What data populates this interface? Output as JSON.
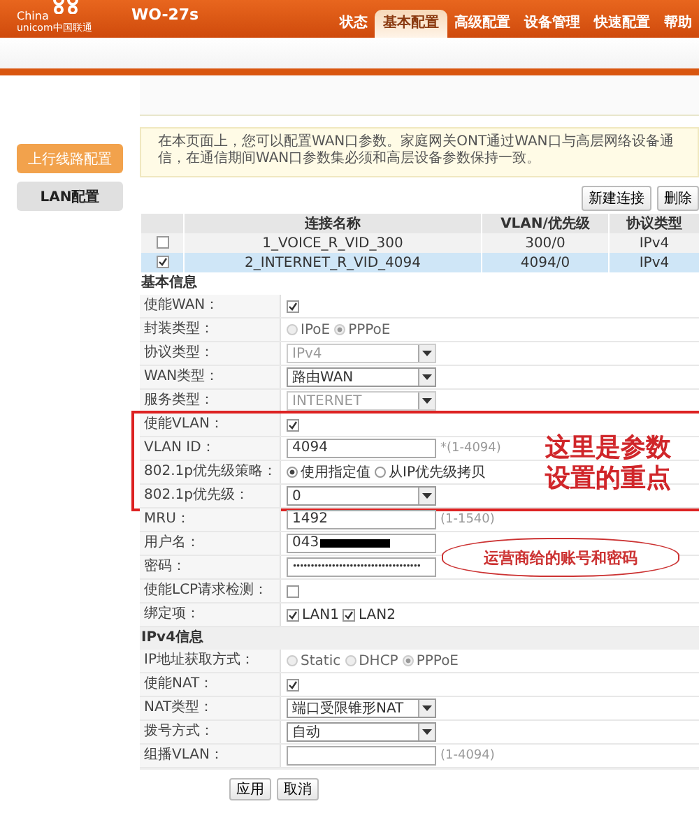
{
  "header": {
    "logo_line1": "China",
    "logo_line2": "unicom中国联通",
    "model": "WO-27s",
    "nav": [
      {
        "label": "状态",
        "selected": false
      },
      {
        "label": "基本配置",
        "selected": true
      },
      {
        "label": "高级配置",
        "selected": false
      },
      {
        "label": "设备管理",
        "selected": false
      },
      {
        "label": "快速配置",
        "selected": false
      },
      {
        "label": "帮助",
        "selected": false
      }
    ]
  },
  "sidebar": {
    "items": [
      {
        "label": "上行线路配置",
        "selected": true
      },
      {
        "label": "LAN配置",
        "selected": false
      }
    ]
  },
  "intro": "在本页面上，您可以配置WAN口参数。家庭网关ONT通过WAN口与高层网络设备通信，在通信期间WAN口参数集必须和高层设备参数保持一致。",
  "toolbar": [
    "新建连接",
    "删除"
  ],
  "table": {
    "columns": [
      "连接名称",
      "VLAN/优先级",
      "协议类型"
    ],
    "rows": [
      {
        "checked": false,
        "selected": false,
        "cells": [
          "1_VOICE_R_VID_300",
          "300/0",
          "IPv4"
        ]
      },
      {
        "checked": true,
        "selected": true,
        "cells": [
          "2_INTERNET_R_VID_4094",
          "4094/0",
          "IPv4"
        ]
      }
    ]
  },
  "sections": [
    {
      "title": "基本信息",
      "groups": [
        {
          "highlighted": false,
          "rows": [
            {
              "kind": "checkbox",
              "label": "使能WAN：",
              "checked": true
            },
            {
              "kind": "radio",
              "label": "封装类型：",
              "disabled": true,
              "options": [
                {
                  "label": "IPoE",
                  "selected": false
                },
                {
                  "label": "PPPoE",
                  "selected": true
                }
              ]
            },
            {
              "kind": "select",
              "label": "协议类型：",
              "value": "IPv4",
              "disabled": true
            },
            {
              "kind": "select",
              "label": "WAN类型：",
              "value": "路由WAN",
              "disabled": false
            },
            {
              "kind": "select",
              "label": "服务类型：",
              "value": "INTERNET",
              "disabled": true
            }
          ]
        },
        {
          "highlighted": true,
          "note": "这里是参数设置的重点",
          "rows": [
            {
              "kind": "checkbox",
              "label": "使能VLAN：",
              "checked": true
            },
            {
              "kind": "text",
              "label": "VLAN ID：",
              "value": "4094",
              "hint": "*(1-4094)"
            },
            {
              "kind": "radio",
              "label": "802.1p优先级策略：",
              "disabled": false,
              "options": [
                {
                  "label": "使用指定值",
                  "selected": true
                },
                {
                  "label": "从IP优先级拷贝",
                  "selected": false
                }
              ]
            },
            {
              "kind": "select",
              "label": "802.1p优先级：",
              "value": "0",
              "disabled": false
            }
          ]
        },
        {
          "highlighted": false,
          "callout": "运营商给的账号和密码",
          "rows": [
            {
              "kind": "text",
              "label": "MRU：",
              "value": "1492",
              "hint": "(1-1540)"
            },
            {
              "kind": "text",
              "label": "用户名：",
              "value": "043",
              "redacted": true
            },
            {
              "kind": "password",
              "label": "密码：",
              "value": "••••••••••••••••••••••••••••••••••••"
            },
            {
              "kind": "checkbox",
              "label": "使能LCP请求检测：",
              "checked": false
            },
            {
              "kind": "checkboxes",
              "label": "绑定项：",
              "options": [
                {
                  "label": "LAN1",
                  "checked": true
                },
                {
                  "label": "LAN2",
                  "checked": true
                }
              ]
            }
          ]
        }
      ]
    },
    {
      "title": "IPv4信息",
      "groups": [
        {
          "highlighted": false,
          "rows": [
            {
              "kind": "radio",
              "label": "IP地址获取方式：",
              "disabled": true,
              "options": [
                {
                  "label": "Static",
                  "selected": false
                },
                {
                  "label": "DHCP",
                  "selected": false
                },
                {
                  "label": "PPPoE",
                  "selected": true
                }
              ]
            },
            {
              "kind": "checkbox",
              "label": "使能NAT：",
              "checked": true
            },
            {
              "kind": "select",
              "label": "NAT类型：",
              "value": "端口受限锥形NAT",
              "disabled": false
            },
            {
              "kind": "select",
              "label": "拨号方式：",
              "value": "自动",
              "disabled": false
            },
            {
              "kind": "text",
              "label": "组播VLAN：",
              "hint": "(1-4094)"
            }
          ]
        }
      ]
    }
  ],
  "actions": [
    "应用",
    "取消"
  ]
}
